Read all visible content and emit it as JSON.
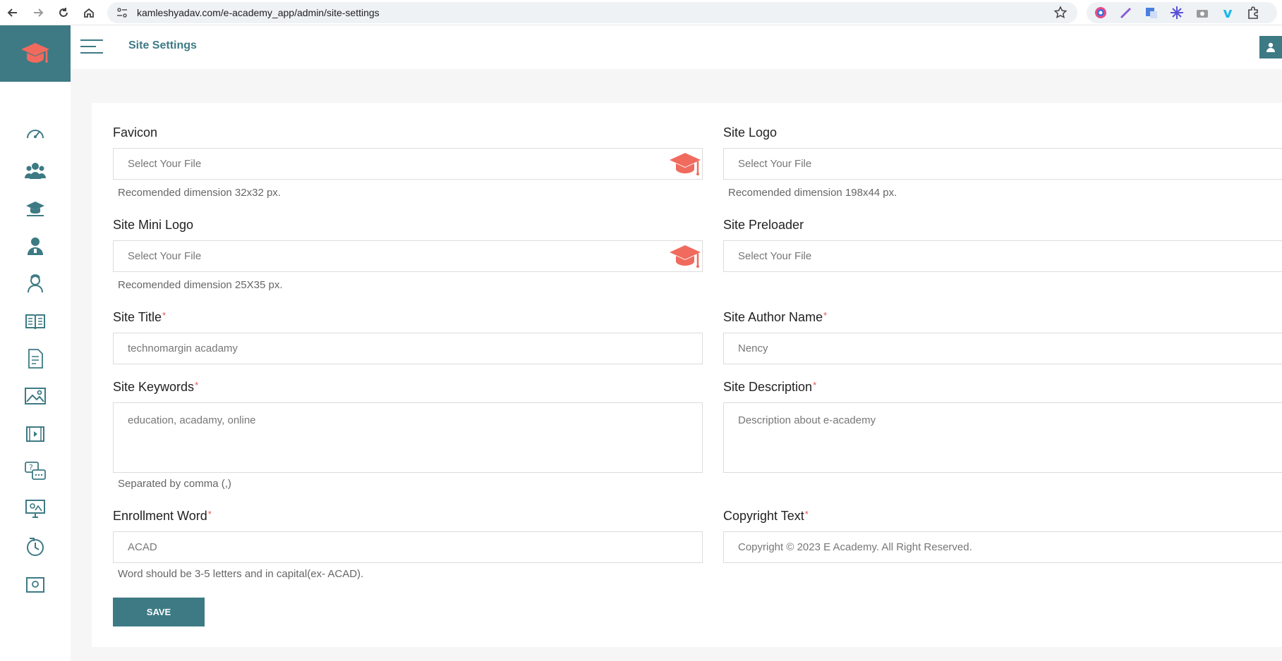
{
  "browser": {
    "url": "kamleshyadav.com/e-academy_app/admin/site-settings"
  },
  "header": {
    "title": "Site Settings"
  },
  "sidebar": {
    "items": [
      {
        "icon": "dashboard-gauge-icon"
      },
      {
        "icon": "users-group-icon"
      },
      {
        "icon": "courses-cap-icon"
      },
      {
        "icon": "teacher-icon"
      },
      {
        "icon": "student-icon"
      },
      {
        "icon": "book-icon"
      },
      {
        "icon": "exam-document-icon"
      },
      {
        "icon": "gallery-image-icon"
      },
      {
        "icon": "video-icon"
      },
      {
        "icon": "question-chat-icon"
      },
      {
        "icon": "live-class-icon"
      },
      {
        "icon": "settings-cycle-icon"
      },
      {
        "icon": "certificate-icon"
      }
    ]
  },
  "form": {
    "favicon": {
      "label": "Favicon",
      "placeholder": "Select Your File",
      "hint": "Recomended dimension 32x32 px."
    },
    "site_logo": {
      "label": "Site Logo",
      "placeholder": "Select Your File",
      "hint": "Recomended dimension 198x44 px."
    },
    "site_mini_logo": {
      "label": "Site Mini Logo",
      "placeholder": "Select Your File",
      "hint": "Recomended dimension 25X35 px."
    },
    "site_preloader": {
      "label": "Site Preloader",
      "placeholder": "Select Your File"
    },
    "site_title": {
      "label": "Site Title",
      "required": "*",
      "value": "technomargin acadamy"
    },
    "site_author": {
      "label": "Site Author Name",
      "required": "*",
      "value": "Nency"
    },
    "site_keywords": {
      "label": "Site Keywords",
      "required": "*",
      "value": "education, acadamy, online",
      "hint": "Separated by comma (,)"
    },
    "site_description": {
      "label": "Site Description",
      "required": "*",
      "value": "Description about e-academy"
    },
    "enrollment_word": {
      "label": "Enrollment Word",
      "required": "*",
      "value": "ACAD",
      "hint": "Word should be 3-5 letters and in capital(ex- ACAD)."
    },
    "copyright": {
      "label": "Copyright Text",
      "required": "*",
      "value": "Copyright © 2023 E Academy. All Right Reserved."
    },
    "save_label": "SAVE"
  },
  "colors": {
    "brand": "#3d7a84",
    "accent": "#f06a5e",
    "required": "#e8534a"
  }
}
